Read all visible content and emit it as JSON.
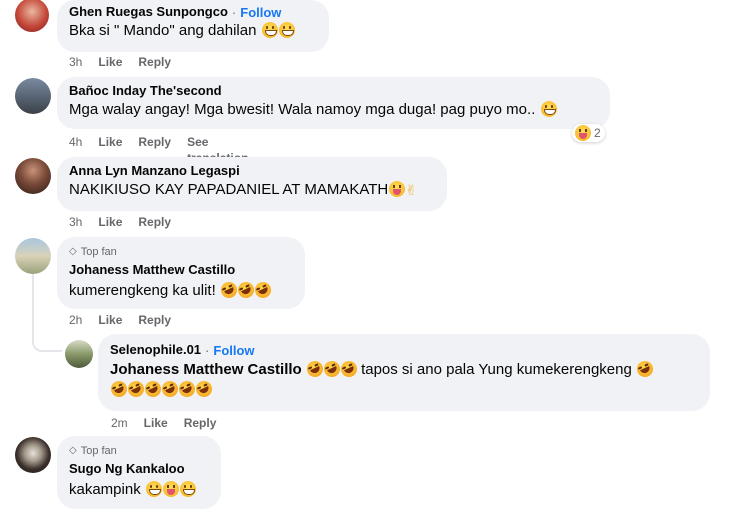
{
  "comments": [
    {
      "name": "Ghen Ruegas Sunpongco",
      "follow": "Follow",
      "text": "Bka si \" Mando\" ang dahilan",
      "time": "3h",
      "like": "Like",
      "reply": "Reply"
    },
    {
      "name": "Bañoc Inday The'second",
      "text": "Mga walay angay! Mga bwesit! Wala namoy mga duga! pag puyo mo..",
      "time": "4h",
      "like": "Like",
      "reply": "Reply",
      "see_translation": "See translation",
      "reaction_count": "2"
    },
    {
      "name": "Anna Lyn Manzano Legaspi",
      "text": "NAKIKIUSO KAY PAPADANIEL AT MAMAKATH",
      "time": "3h",
      "like": "Like",
      "reply": "Reply"
    },
    {
      "badge": "Top fan",
      "name": "Johaness Matthew Castillo",
      "text": "kumerengkeng ka ulit!",
      "time": "2h",
      "like": "Like",
      "reply": "Reply"
    },
    {
      "name": "Selenophile.01",
      "follow": "Follow",
      "mention": "Johaness Matthew Castillo",
      "text": "tapos si ano pala Yung kumekerengkeng",
      "time": "2m",
      "like": "Like",
      "reply": "Reply"
    },
    {
      "badge": "Top fan",
      "name": "Sugo Ng Kankaloo",
      "text": "kakampink",
      "time": "",
      "like": "",
      "reply": ""
    }
  ],
  "separator": "·",
  "colors": {
    "link": "#1877f2",
    "bubble": "#f0f2f5",
    "meta": "#65676b"
  }
}
